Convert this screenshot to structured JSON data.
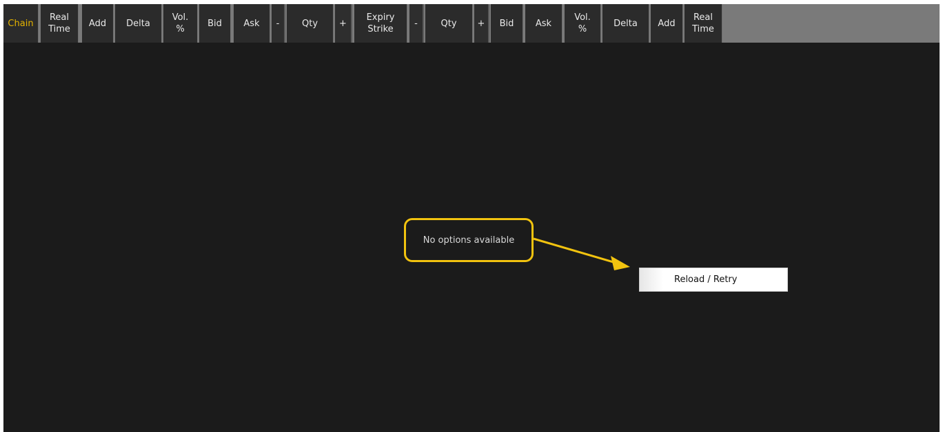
{
  "header": {
    "columns": [
      {
        "id": "chain",
        "label": "Chain"
      },
      {
        "id": "call-real-time",
        "label": "Real\nTime"
      },
      {
        "id": "call-add",
        "label": "Add"
      },
      {
        "id": "call-delta",
        "label": "Delta"
      },
      {
        "id": "call-vol-pct",
        "label": "Vol.\n%"
      },
      {
        "id": "call-bid",
        "label": "Bid"
      },
      {
        "id": "call-ask",
        "label": "Ask"
      },
      {
        "id": "call-minus",
        "label": "-"
      },
      {
        "id": "call-qty",
        "label": "Qty"
      },
      {
        "id": "call-plus",
        "label": "+"
      },
      {
        "id": "expiry-strike",
        "label": "Expiry\nStrike"
      },
      {
        "id": "put-minus",
        "label": "-"
      },
      {
        "id": "put-qty",
        "label": "Qty"
      },
      {
        "id": "put-plus",
        "label": "+"
      },
      {
        "id": "put-bid",
        "label": "Bid"
      },
      {
        "id": "put-ask",
        "label": "Ask"
      },
      {
        "id": "put-vol-pct",
        "label": "Vol.\n%"
      },
      {
        "id": "put-delta",
        "label": "Delta"
      },
      {
        "id": "put-add",
        "label": "Add"
      },
      {
        "id": "put-real-time",
        "label": "Real\nTime"
      }
    ]
  },
  "message": {
    "text": "No options available"
  },
  "reload_button": {
    "label": "Reload / Retry"
  },
  "colors": {
    "accent": "#e5b400",
    "callout": "#f2c30f",
    "background": "#1b1b1b"
  }
}
